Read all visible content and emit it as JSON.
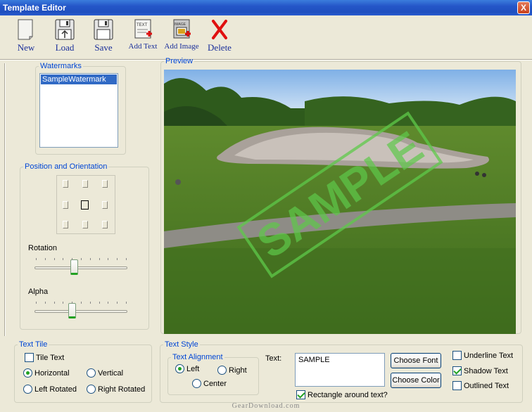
{
  "window": {
    "title": "Template Editor",
    "close_glyph": "X"
  },
  "toolbar": {
    "new_label": "New",
    "load_label": "Load",
    "save_label": "Save",
    "add_text_label": "Add Text",
    "add_image_label": "Add Image",
    "delete_label": "Delete",
    "add_text_icon_text": "TEXT",
    "add_image_icon_text": "IMAGE"
  },
  "watermarks": {
    "legend": "Watermarks",
    "items": [
      "SampleWatermark"
    ],
    "selected_index": 0
  },
  "position": {
    "legend": "Position and Orientation",
    "selected_cell": "center",
    "rotation_label": "Rotation",
    "rotation_value": 0.42,
    "alpha_label": "Alpha",
    "alpha_value": 0.4
  },
  "preview": {
    "legend": "Preview",
    "watermark_text": "SAMPLE",
    "watermark_color": "#5ec94a"
  },
  "text_tile": {
    "legend": "Text Tile",
    "tile_text_label": "Tile Text",
    "tile_text_checked": false,
    "horizontal_label": "Horizontal",
    "vertical_label": "Vertical",
    "left_rotated_label": "Left Rotated",
    "right_rotated_label": "Right Rotated",
    "selected": "horizontal"
  },
  "text_style": {
    "legend": "Text Style",
    "alignment_legend": "Text Alignment",
    "left_label": "Left",
    "right_label": "Right",
    "center_label": "Center",
    "alignment_selected": "left",
    "text_label": "Text:",
    "text_value": "SAMPLE",
    "choose_font_label": "Choose Font",
    "choose_color_label": "Choose Color",
    "rectangle_label": "Rectangle around text?",
    "rectangle_checked": true,
    "underline_label": "Underline Text",
    "underline_checked": false,
    "shadow_label": "Shadow Text",
    "shadow_checked": true,
    "outlined_label": "Outlined Text",
    "outlined_checked": false
  },
  "footer": {
    "credit": "GearDownload.com"
  },
  "colors": {
    "accent_green": "#21a121",
    "title_blue": "#2456c8",
    "legend_blue": "#0046d5"
  }
}
